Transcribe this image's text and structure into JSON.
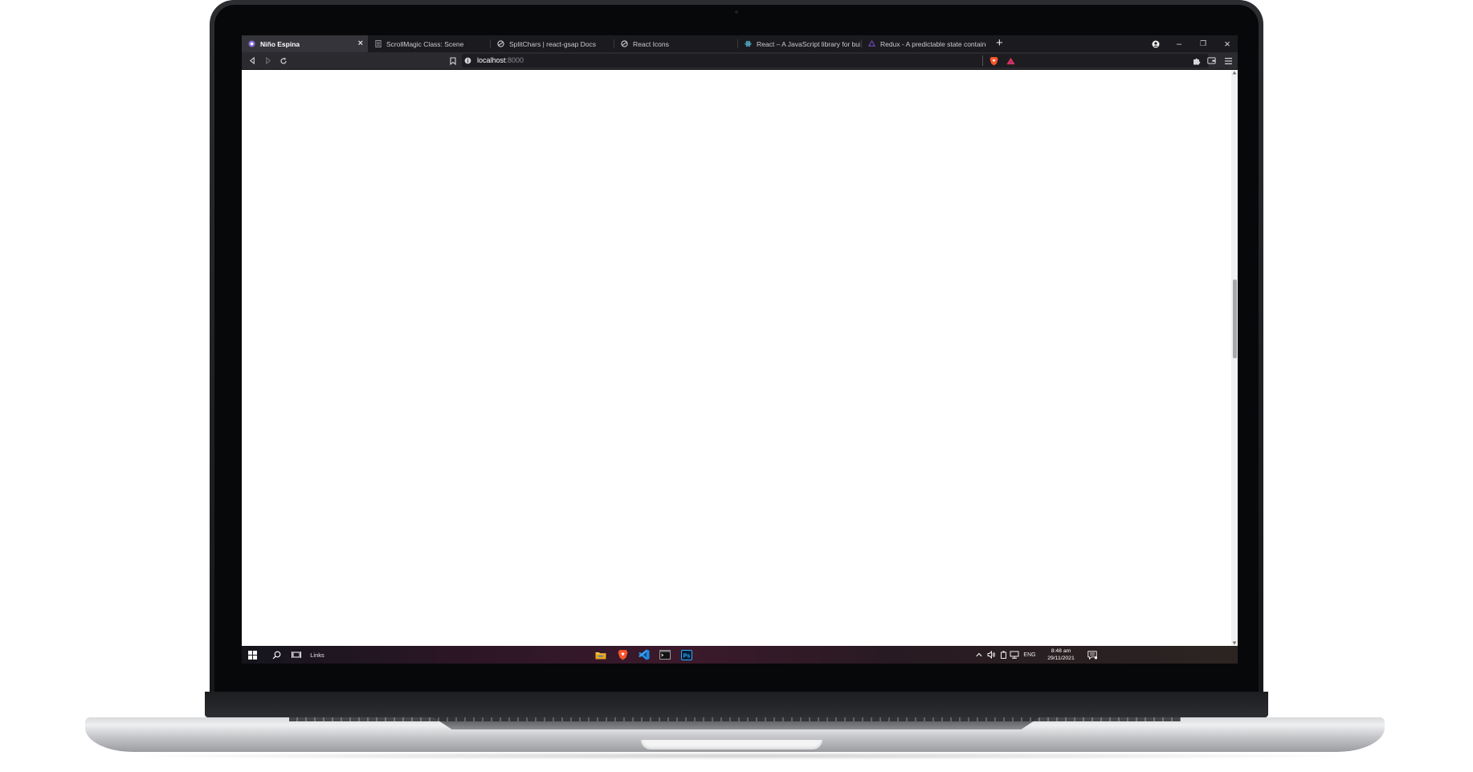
{
  "browser": {
    "tabs": [
      {
        "title": "Niño Espina",
        "active": true,
        "favicon": "nino-espina-favicon",
        "close": "×"
      },
      {
        "title": "ScrollMagic Class: Scene",
        "active": false,
        "favicon": "document-favicon"
      },
      {
        "title": "SplitChars | react-gsap Docs",
        "active": false,
        "favicon": "globe-favicon"
      },
      {
        "title": "React Icons",
        "active": false,
        "favicon": "globe-favicon"
      },
      {
        "title": "React – A JavaScript library for buildin",
        "active": false,
        "favicon": "react-favicon"
      },
      {
        "title": "Redux - A predictable state container",
        "active": false,
        "favicon": "redux-favicon"
      }
    ],
    "new_tab": "+",
    "window_controls": {
      "minimize": "–",
      "restore": "❐",
      "close": "×"
    },
    "address": {
      "host": "localhost",
      "port": ":8000"
    },
    "scroll_position": 0.42
  },
  "taskbar": {
    "search_links_label": "Links",
    "language": "ENG",
    "time": "8:48 am",
    "date": "29/11/2021"
  },
  "colors": {
    "tab_bar": "#1b1b1f",
    "active_tab": "#34343a",
    "toolbar": "#2a2a2f",
    "brave_orange": "#fb542b",
    "vscode_blue": "#1e88e5",
    "photoshop_blue": "#31a8ff"
  }
}
